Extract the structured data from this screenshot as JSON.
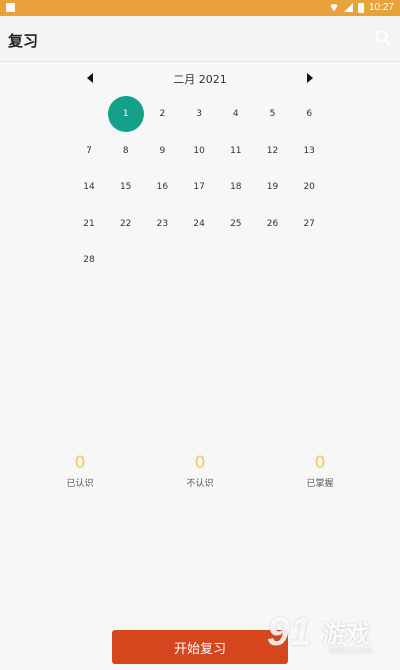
{
  "status_bar": {
    "time": "10:27",
    "icons": [
      "notification-icon",
      "wifi-icon",
      "signal-icon",
      "battery-icon"
    ]
  },
  "app_bar": {
    "title": "复习",
    "search_icon": "search-icon"
  },
  "calendar": {
    "month_label": "二月 2021",
    "prev_icon": "triangle-left-icon",
    "next_icon": "triangle-right-icon",
    "selected_day": 1,
    "selected_color": "#15a08a",
    "weeks": [
      [
        "",
        "",
        "",
        "1",
        "2",
        "3",
        "4",
        "5",
        "6"
      ],
      [
        "7",
        "8",
        "9",
        "10",
        "11",
        "12",
        "13"
      ],
      [
        "14",
        "15",
        "16",
        "17",
        "18",
        "19",
        "20"
      ],
      [
        "21",
        "22",
        "23",
        "24",
        "25",
        "26",
        "27"
      ],
      [
        "28"
      ]
    ]
  },
  "stats": [
    {
      "value": "0",
      "label": "已认识"
    },
    {
      "value": "0",
      "label": "不认识"
    },
    {
      "value": "0",
      "label": "已掌握"
    }
  ],
  "start_button": {
    "label": "开始复习",
    "color": "#d6461e"
  },
  "watermark": {
    "logo": "91",
    "text": "游戏",
    "url": "91danji.com"
  },
  "colors": {
    "status_bar": "#e9a23b",
    "accent_number": "#f2c462"
  }
}
